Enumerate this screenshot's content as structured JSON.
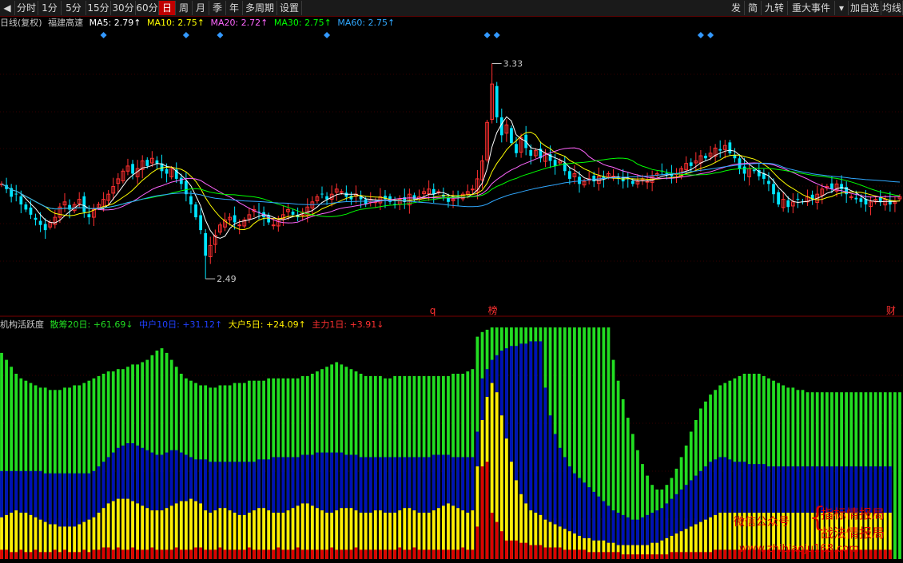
{
  "toolbar": {
    "left_buttons": [
      {
        "label": "◀",
        "name": "period-prev-button",
        "active": false
      },
      {
        "label": "分时",
        "name": "period-button-intraday",
        "active": false
      },
      {
        "label": "1分",
        "name": "period-button-1min",
        "active": false
      },
      {
        "label": "5分",
        "name": "period-button-5min",
        "active": false
      },
      {
        "label": "15分",
        "name": "period-button-15min",
        "active": false
      },
      {
        "label": "30分",
        "name": "period-button-30min",
        "active": false
      },
      {
        "label": "60分",
        "name": "period-button-60min",
        "active": false
      },
      {
        "label": "日",
        "name": "period-button-day",
        "active": true
      },
      {
        "label": "周",
        "name": "period-button-week",
        "active": false
      },
      {
        "label": "月",
        "name": "period-button-month",
        "active": false
      },
      {
        "label": "季",
        "name": "period-button-quarter",
        "active": false
      },
      {
        "label": "年",
        "name": "period-button-year",
        "active": false
      },
      {
        "label": "多周期",
        "name": "multi-period-button",
        "active": false
      },
      {
        "label": "设置",
        "name": "settings-button",
        "active": false
      }
    ],
    "right_buttons": [
      {
        "label": "发",
        "name": "publish-button"
      },
      {
        "label": "简",
        "name": "simple-button"
      },
      {
        "label": "九转",
        "name": "nine-turn-button"
      },
      {
        "label": "重大事件",
        "name": "major-events-button"
      },
      {
        "label": "▾",
        "name": "events-dropdown-button"
      },
      {
        "label": "加自选",
        "name": "add-watchlist-button"
      },
      {
        "label": "均线",
        "name": "ma-button"
      }
    ]
  },
  "info_bar": {
    "period": "日线(复权)",
    "stock": "福建高速",
    "ma5": "MA5: 2.79↑",
    "ma10": "MA10: 2.75↑",
    "ma20": "MA20: 2.72↑",
    "ma30": "MA30: 2.75↑",
    "ma60": "MA60: 2.75↑"
  },
  "indicator_bar": {
    "name": "机构活跃度",
    "retail": "散筹20日: +61.69↓",
    "mid": "中户10日: +31.12↑",
    "big": "大户5日: +24.09↑",
    "main": "主力1日: +3.91↓"
  },
  "watermark": {
    "wechat": "微信公众号",
    "line1": "指标情报局",
    "line2": "战法情报局",
    "site": "www.zhibiaoju168.com"
  },
  "colors": {
    "up": "#ff3030",
    "down": "#00e5ff",
    "ma5": "#ffffff",
    "ma10": "#ffff00",
    "ma20": "#ff66ff",
    "ma30": "#00ff00",
    "ma60": "#30a8ff",
    "green_bar": "#22dd22",
    "blue_bar": "#0010b8",
    "yellow_bar": "#ffee00",
    "red_bar": "#dd0000",
    "marker": "#3399ff"
  },
  "chart_data": [
    {
      "type": "candlestick",
      "title": "日线(复权) 福建高速",
      "ylim": [
        2.4,
        3.4
      ],
      "annotations": [
        {
          "index": 101,
          "value": 3.33,
          "label": "3.33"
        },
        {
          "index": 42,
          "value": 2.49,
          "label": "2.49"
        }
      ],
      "event_labels": [
        {
          "index": 89,
          "text": "q",
          "color": "#ff3030"
        },
        {
          "index": 101,
          "text": "榜",
          "color": "#ff3030"
        },
        {
          "index": 183,
          "text": "财",
          "color": "#ff3030"
        }
      ],
      "diamond_indexes": [
        21,
        38,
        45,
        67,
        100,
        102,
        144,
        146,
        187
      ],
      "close": [
        2.86,
        2.84,
        2.81,
        2.82,
        2.78,
        2.76,
        2.74,
        2.72,
        2.7,
        2.68,
        2.71,
        2.73,
        2.77,
        2.79,
        2.76,
        2.78,
        2.8,
        2.75,
        2.73,
        2.76,
        2.78,
        2.8,
        2.82,
        2.85,
        2.88,
        2.91,
        2.93,
        2.9,
        2.92,
        2.95,
        2.93,
        2.96,
        2.94,
        2.91,
        2.9,
        2.92,
        2.88,
        2.86,
        2.82,
        2.78,
        2.73,
        2.68,
        2.58,
        2.62,
        2.66,
        2.7,
        2.72,
        2.73,
        2.71,
        2.7,
        2.72,
        2.74,
        2.76,
        2.75,
        2.73,
        2.71,
        2.7,
        2.72,
        2.74,
        2.76,
        2.74,
        2.73,
        2.75,
        2.77,
        2.79,
        2.81,
        2.82,
        2.8,
        2.82,
        2.84,
        2.83,
        2.81,
        2.8,
        2.82,
        2.8,
        2.78,
        2.8,
        2.79,
        2.81,
        2.8,
        2.79,
        2.78,
        2.8,
        2.79,
        2.82,
        2.8,
        2.81,
        2.83,
        2.84,
        2.82,
        2.83,
        2.81,
        2.79,
        2.8,
        2.81,
        2.82,
        2.83,
        2.84,
        2.88,
        2.95,
        3.1,
        3.25,
        3.12,
        3.05,
        3.09,
        3.02,
        2.98,
        3.04,
        3.0,
        2.97,
        2.99,
        2.96,
        2.98,
        2.95,
        2.93,
        2.95,
        2.91,
        2.88,
        2.9,
        2.86,
        2.87,
        2.88,
        2.87,
        2.89,
        2.88,
        2.9,
        2.89,
        2.88,
        2.87,
        2.88,
        2.86,
        2.87,
        2.88,
        2.87,
        2.89,
        2.9,
        2.91,
        2.9,
        2.89,
        2.9,
        2.92,
        2.94,
        2.93,
        2.95,
        2.97,
        2.96,
        2.98,
        3.0,
        2.99,
        3.01,
        2.98,
        2.96,
        2.92,
        2.9,
        2.92,
        2.91,
        2.89,
        2.88,
        2.86,
        2.82,
        2.78,
        2.8,
        2.77,
        2.79,
        2.8,
        2.79,
        2.81,
        2.8,
        2.82,
        2.84,
        2.85,
        2.84,
        2.86,
        2.84,
        2.82,
        2.81,
        2.8,
        2.79,
        2.78,
        2.79,
        2.8,
        2.79,
        2.8,
        2.78,
        2.79,
        2.81
      ]
    },
    {
      "type": "stacked_bar",
      "title": "机构活跃度",
      "ylim": [
        0,
        100
      ],
      "series_names": [
        "主力1日",
        "大户5日",
        "中户10日",
        "散筹20日"
      ],
      "red": [
        4,
        4,
        3,
        3,
        4,
        3,
        3,
        4,
        3,
        3,
        3,
        4,
        3,
        4,
        3,
        3,
        3,
        4,
        3,
        4,
        4,
        5,
        5,
        4,
        5,
        4,
        4,
        5,
        4,
        4,
        4,
        5,
        4,
        4,
        4,
        4,
        5,
        4,
        4,
        4,
        5,
        5,
        4,
        4,
        4,
        5,
        4,
        4,
        4,
        4,
        4,
        5,
        4,
        4,
        4,
        4,
        4,
        5,
        4,
        4,
        4,
        5,
        4,
        4,
        4,
        4,
        4,
        4,
        5,
        4,
        4,
        4,
        4,
        5,
        4,
        4,
        4,
        4,
        4,
        4,
        4,
        4,
        5,
        4,
        4,
        5,
        4,
        4,
        4,
        4,
        4,
        4,
        4,
        4,
        4,
        5,
        4,
        4,
        14,
        40,
        42,
        20,
        16,
        12,
        8,
        8,
        8,
        7,
        7,
        6,
        6,
        6,
        5,
        5,
        5,
        5,
        4,
        4,
        4,
        4,
        4,
        3,
        3,
        3,
        3,
        3,
        3,
        3,
        2,
        2,
        2,
        2,
        2,
        2,
        2,
        2,
        2,
        2,
        3,
        3,
        3,
        3,
        3,
        3,
        3,
        3,
        3,
        4,
        4,
        4,
        4,
        4,
        4,
        4,
        4,
        4,
        4,
        4,
        4,
        4,
        4,
        4,
        4,
        4,
        4,
        4,
        4,
        4,
        4,
        4,
        4,
        4,
        4,
        4,
        4,
        4,
        4,
        4,
        4,
        4,
        4,
        4,
        4,
        4
      ],
      "yellow": [
        18,
        19,
        20,
        21,
        20,
        20,
        19,
        18,
        17,
        16,
        15,
        15,
        14,
        14,
        14,
        14,
        15,
        16,
        17,
        18,
        20,
        22,
        24,
        25,
        26,
        26,
        26,
        25,
        24,
        23,
        22,
        21,
        21,
        21,
        22,
        23,
        24,
        25,
        25,
        26,
        25,
        24,
        21,
        20,
        21,
        22,
        22,
        21,
        20,
        19,
        19,
        20,
        21,
        22,
        22,
        21,
        20,
        20,
        20,
        21,
        22,
        23,
        24,
        24,
        23,
        22,
        21,
        20,
        20,
        21,
        22,
        22,
        22,
        21,
        20,
        20,
        20,
        21,
        21,
        20,
        20,
        20,
        21,
        22,
        22,
        21,
        20,
        20,
        20,
        21,
        22,
        23,
        24,
        23,
        22,
        21,
        20,
        21,
        40,
        60,
        70,
        76,
        72,
        62,
        52,
        42,
        34,
        28,
        24,
        21,
        20,
        19,
        17,
        16,
        15,
        14,
        13,
        12,
        11,
        10,
        9,
        9,
        8,
        8,
        8,
        7,
        7,
        6,
        6,
        6,
        6,
        6,
        6,
        6,
        7,
        7,
        8,
        9,
        10,
        11,
        12,
        13,
        14,
        15,
        16,
        17,
        18,
        19,
        20,
        20,
        20,
        20,
        20,
        20,
        20,
        20,
        20,
        20,
        20,
        20,
        20,
        20,
        20,
        20,
        20,
        20,
        20,
        20,
        20,
        20,
        20,
        20,
        20,
        20,
        20,
        20,
        20,
        20,
        20,
        20,
        20,
        20,
        20,
        20
      ],
      "blue": [
        38,
        38,
        38,
        38,
        38,
        38,
        38,
        38,
        38,
        37,
        37,
        37,
        37,
        37,
        37,
        37,
        37,
        37,
        37,
        38,
        40,
        42,
        44,
        46,
        48,
        49,
        50,
        50,
        49,
        48,
        47,
        46,
        45,
        45,
        46,
        47,
        47,
        46,
        45,
        44,
        43,
        43,
        43,
        42,
        42,
        42,
        42,
        42,
        42,
        42,
        42,
        42,
        42,
        43,
        43,
        43,
        44,
        44,
        44,
        44,
        44,
        44,
        45,
        45,
        45,
        46,
        46,
        46,
        46,
        46,
        46,
        45,
        45,
        45,
        44,
        44,
        44,
        44,
        44,
        44,
        44,
        44,
        44,
        44,
        44,
        44,
        44,
        44,
        44,
        45,
        45,
        45,
        45,
        44,
        44,
        44,
        44,
        44,
        55,
        78,
        82,
        86,
        88,
        90,
        91,
        92,
        92,
        93,
        93,
        94,
        94,
        94,
        74,
        62,
        54,
        48,
        44,
        40,
        37,
        35,
        33,
        31,
        29,
        27,
        25,
        23,
        21,
        20,
        19,
        18,
        17,
        17,
        18,
        19,
        20,
        21,
        22,
        24,
        26,
        28,
        30,
        32,
        34,
        36,
        38,
        40,
        42,
        43,
        44,
        44,
        43,
        42,
        42,
        42,
        41,
        41,
        41,
        41,
        40,
        40,
        40,
        40,
        40,
        40,
        40,
        40,
        40,
        40,
        40,
        40,
        40,
        40,
        40,
        40,
        40,
        40,
        40,
        40,
        40,
        40,
        40,
        40,
        40,
        40
      ],
      "green": [
        89,
        86,
        83,
        80,
        78,
        77,
        76,
        75,
        74,
        74,
        73,
        73,
        73,
        74,
        74,
        75,
        75,
        76,
        77,
        78,
        79,
        80,
        81,
        81,
        82,
        82,
        83,
        84,
        84,
        85,
        86,
        88,
        90,
        91,
        89,
        86,
        83,
        80,
        78,
        77,
        76,
        75,
        75,
        74,
        74,
        75,
        75,
        75,
        76,
        76,
        76,
        77,
        77,
        77,
        77,
        78,
        78,
        78,
        78,
        78,
        78,
        78,
        79,
        79,
        80,
        81,
        82,
        83,
        84,
        85,
        84,
        83,
        82,
        81,
        80,
        79,
        79,
        79,
        79,
        78,
        78,
        79,
        79,
        79,
        79,
        79,
        79,
        79,
        79,
        79,
        79,
        79,
        79,
        80,
        80,
        80,
        81,
        82,
        96,
        98,
        99,
        100,
        100,
        100,
        100,
        100,
        100,
        100,
        100,
        100,
        100,
        100,
        100,
        100,
        100,
        100,
        100,
        100,
        100,
        100,
        100,
        100,
        100,
        100,
        100,
        100,
        86,
        77,
        69,
        61,
        54,
        47,
        41,
        36,
        32,
        30,
        30,
        32,
        35,
        39,
        44,
        49,
        55,
        60,
        65,
        68,
        71,
        73,
        75,
        76,
        77,
        78,
        79,
        80,
        80,
        80,
        80,
        79,
        78,
        77,
        76,
        75,
        74,
        74,
        73,
        73,
        72,
        72,
        72,
        72,
        72,
        72,
        72,
        72,
        72,
        72,
        72,
        72,
        72,
        72,
        72,
        72,
        72,
        72,
        72,
        72,
        72,
        72
      ]
    }
  ]
}
